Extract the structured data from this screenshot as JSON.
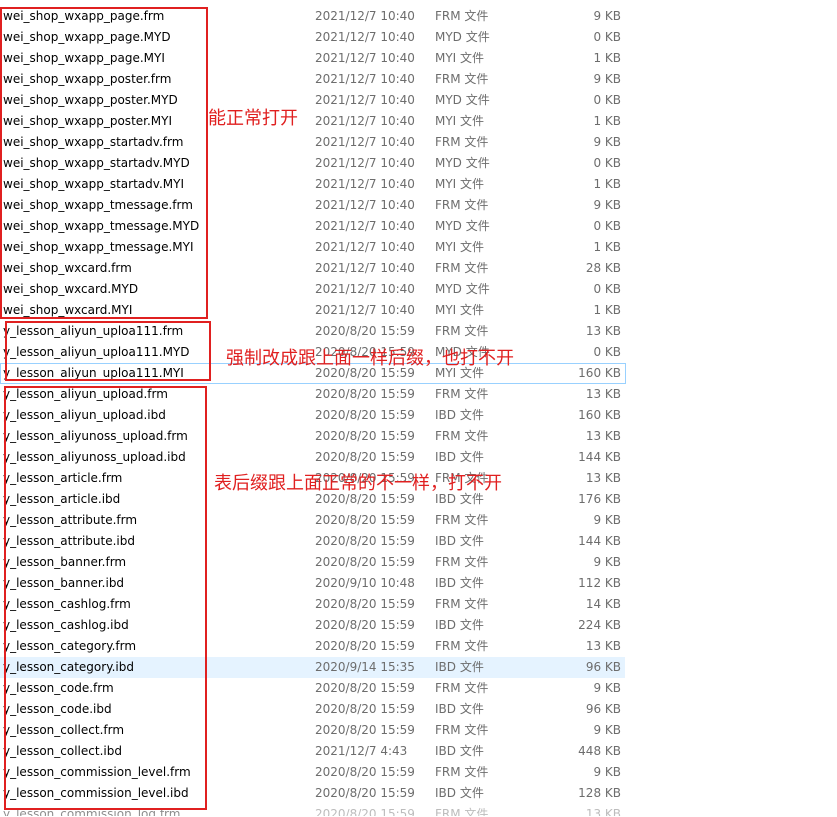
{
  "files": [
    {
      "name": "wei_shop_wxapp_page.frm",
      "date": "2021/12/7 10:40",
      "type": "FRM 文件",
      "size": "9 KB"
    },
    {
      "name": "wei_shop_wxapp_page.MYD",
      "date": "2021/12/7 10:40",
      "type": "MYD 文件",
      "size": "0 KB"
    },
    {
      "name": "wei_shop_wxapp_page.MYI",
      "date": "2021/12/7 10:40",
      "type": "MYI 文件",
      "size": "1 KB"
    },
    {
      "name": "wei_shop_wxapp_poster.frm",
      "date": "2021/12/7 10:40",
      "type": "FRM 文件",
      "size": "9 KB"
    },
    {
      "name": "wei_shop_wxapp_poster.MYD",
      "date": "2021/12/7 10:40",
      "type": "MYD 文件",
      "size": "0 KB"
    },
    {
      "name": "wei_shop_wxapp_poster.MYI",
      "date": "2021/12/7 10:40",
      "type": "MYI 文件",
      "size": "1 KB"
    },
    {
      "name": "wei_shop_wxapp_startadv.frm",
      "date": "2021/12/7 10:40",
      "type": "FRM 文件",
      "size": "9 KB"
    },
    {
      "name": "wei_shop_wxapp_startadv.MYD",
      "date": "2021/12/7 10:40",
      "type": "MYD 文件",
      "size": "0 KB"
    },
    {
      "name": "wei_shop_wxapp_startadv.MYI",
      "date": "2021/12/7 10:40",
      "type": "MYI 文件",
      "size": "1 KB"
    },
    {
      "name": "wei_shop_wxapp_tmessage.frm",
      "date": "2021/12/7 10:40",
      "type": "FRM 文件",
      "size": "9 KB"
    },
    {
      "name": "wei_shop_wxapp_tmessage.MYD",
      "date": "2021/12/7 10:40",
      "type": "MYD 文件",
      "size": "0 KB"
    },
    {
      "name": "wei_shop_wxapp_tmessage.MYI",
      "date": "2021/12/7 10:40",
      "type": "MYI 文件",
      "size": "1 KB"
    },
    {
      "name": "wei_shop_wxcard.frm",
      "date": "2021/12/7 10:40",
      "type": "FRM 文件",
      "size": "28 KB"
    },
    {
      "name": "wei_shop_wxcard.MYD",
      "date": "2021/12/7 10:40",
      "type": "MYD 文件",
      "size": "0 KB"
    },
    {
      "name": "wei_shop_wxcard.MYI",
      "date": "2021/12/7 10:40",
      "type": "MYI 文件",
      "size": "1 KB"
    },
    {
      "name": "y_lesson_aliyun_uploa111.frm",
      "date": "2020/8/20 15:59",
      "type": "FRM 文件",
      "size": "13 KB"
    },
    {
      "name": "y_lesson_aliyun_uploa111.MYD",
      "date": "2020/8/20 15:59",
      "type": "MYD 文件",
      "size": "0 KB"
    },
    {
      "name": "y_lesson_aliyun_uploa111.MYI",
      "date": "2020/8/20 15:59",
      "type": "MYI 文件",
      "size": "160 KB",
      "state": "hover"
    },
    {
      "name": "y_lesson_aliyun_upload.frm",
      "date": "2020/8/20 15:59",
      "type": "FRM 文件",
      "size": "13 KB"
    },
    {
      "name": "y_lesson_aliyun_upload.ibd",
      "date": "2020/8/20 15:59",
      "type": "IBD 文件",
      "size": "160 KB"
    },
    {
      "name": "y_lesson_aliyunoss_upload.frm",
      "date": "2020/8/20 15:59",
      "type": "FRM 文件",
      "size": "13 KB"
    },
    {
      "name": "y_lesson_aliyunoss_upload.ibd",
      "date": "2020/8/20 15:59",
      "type": "IBD 文件",
      "size": "144 KB"
    },
    {
      "name": "y_lesson_article.frm",
      "date": "2020/8/20 15:59",
      "type": "FRM 文件",
      "size": "13 KB"
    },
    {
      "name": "y_lesson_article.ibd",
      "date": "2020/8/20 15:59",
      "type": "IBD 文件",
      "size": "176 KB"
    },
    {
      "name": "y_lesson_attribute.frm",
      "date": "2020/8/20 15:59",
      "type": "FRM 文件",
      "size": "9 KB"
    },
    {
      "name": "y_lesson_attribute.ibd",
      "date": "2020/8/20 15:59",
      "type": "IBD 文件",
      "size": "144 KB"
    },
    {
      "name": "y_lesson_banner.frm",
      "date": "2020/8/20 15:59",
      "type": "FRM 文件",
      "size": "9 KB"
    },
    {
      "name": "y_lesson_banner.ibd",
      "date": "2020/9/10 10:48",
      "type": "IBD 文件",
      "size": "112 KB"
    },
    {
      "name": "y_lesson_cashlog.frm",
      "date": "2020/8/20 15:59",
      "type": "FRM 文件",
      "size": "14 KB"
    },
    {
      "name": "y_lesson_cashlog.ibd",
      "date": "2020/8/20 15:59",
      "type": "IBD 文件",
      "size": "224 KB"
    },
    {
      "name": "y_lesson_category.frm",
      "date": "2020/8/20 15:59",
      "type": "FRM 文件",
      "size": "13 KB"
    },
    {
      "name": "y_lesson_category.ibd",
      "date": "2020/9/14 15:35",
      "type": "IBD 文件",
      "size": "96 KB",
      "state": "selected"
    },
    {
      "name": "y_lesson_code.frm",
      "date": "2020/8/20 15:59",
      "type": "FRM 文件",
      "size": "9 KB"
    },
    {
      "name": "y_lesson_code.ibd",
      "date": "2020/8/20 15:59",
      "type": "IBD 文件",
      "size": "96 KB"
    },
    {
      "name": "y_lesson_collect.frm",
      "date": "2020/8/20 15:59",
      "type": "FRM 文件",
      "size": "9 KB"
    },
    {
      "name": "y_lesson_collect.ibd",
      "date": "2021/12/7 4:43",
      "type": "IBD 文件",
      "size": "448 KB"
    },
    {
      "name": "y_lesson_commission_level.frm",
      "date": "2020/8/20 15:59",
      "type": "FRM 文件",
      "size": "9 KB"
    },
    {
      "name": "y_lesson_commission_level.ibd",
      "date": "2020/8/20 15:59",
      "type": "IBD 文件",
      "size": "128 KB"
    },
    {
      "name": "y_lesson_commission_log.frm",
      "date": "2020/8/20 15:59",
      "type": "FRM 文件",
      "size": "13 KB",
      "state": "partial"
    }
  ],
  "annotations": {
    "group1": "能正常打开",
    "group2": "强制改成跟上面一样后缀，也打不开",
    "group3": "表后缀跟上面正常的不一样，打不开"
  },
  "colors": {
    "annotation": "#e02020",
    "selected": "#e5f3ff",
    "hover_border": "#99d1ff"
  }
}
